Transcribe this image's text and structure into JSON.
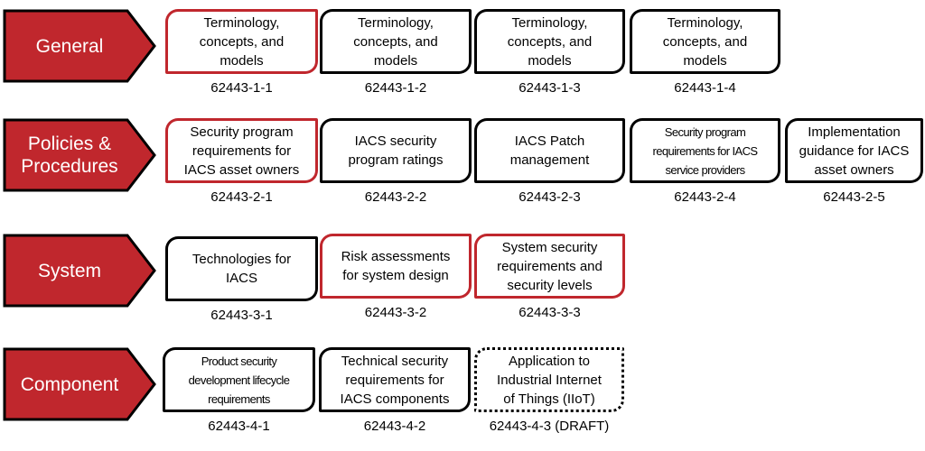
{
  "colors": {
    "accent_red": "#c0272d",
    "arrow_outline": "#000000",
    "box_border": "#000000",
    "text": "#000000"
  },
  "rows": [
    {
      "category": "General",
      "items": [
        {
          "title": "Terminology, concepts, and models",
          "lines": [
            "Terminology,",
            "concepts, and",
            "models"
          ],
          "code": "62443-1-1",
          "highlight": true
        },
        {
          "title": "Terminology, concepts, and models",
          "lines": [
            "Terminology,",
            "concepts, and",
            "models"
          ],
          "code": "62443-1-2",
          "highlight": false
        },
        {
          "title": "Terminology, concepts, and models",
          "lines": [
            "Terminology,",
            "concepts, and",
            "models"
          ],
          "code": "62443-1-3",
          "highlight": false
        },
        {
          "title": "Terminology, concepts, and models",
          "lines": [
            "Terminology,",
            "concepts, and",
            "models"
          ],
          "code": "62443-1-4",
          "highlight": false
        }
      ]
    },
    {
      "category": "Policies & Procedures",
      "items": [
        {
          "lines": [
            "Security program",
            "requirements for",
            "IACS asset owners"
          ],
          "code": "62443-2-1",
          "highlight": true
        },
        {
          "lines": [
            "IACS security",
            "program ratings"
          ],
          "code": "62443-2-2",
          "highlight": false
        },
        {
          "lines": [
            "IACS Patch",
            "management"
          ],
          "code": "62443-2-3",
          "highlight": false
        },
        {
          "lines": [
            "Security program",
            "requirements for IACS",
            "service providers"
          ],
          "code": "62443-2-4",
          "highlight": false
        },
        {
          "lines": [
            "Implementation",
            "guidance for IACS",
            "asset owners"
          ],
          "code": "62443-2-5",
          "highlight": false
        }
      ]
    },
    {
      "category": "System",
      "items": [
        {
          "lines": [
            "Technologies for",
            "IACS"
          ],
          "code": "62443-3-1",
          "highlight": false
        },
        {
          "lines": [
            "Risk assessments",
            "for system design"
          ],
          "code": "62443-3-2",
          "highlight": true
        },
        {
          "lines": [
            "System security",
            "requirements and",
            "security levels"
          ],
          "code": "62443-3-3",
          "highlight": true
        }
      ]
    },
    {
      "category": "Component",
      "items": [
        {
          "lines": [
            "Product security",
            "development lifecycle",
            "requirements"
          ],
          "code": "62443-4-1",
          "highlight": false
        },
        {
          "lines": [
            "Technical security",
            "requirements for",
            "IACS components"
          ],
          "code": "62443-4-2",
          "highlight": false
        },
        {
          "lines": [
            "Application to",
            "Industrial Internet",
            "of Things (IIoT)"
          ],
          "code": "62443-4-3 (DRAFT)",
          "highlight": false,
          "draft": true
        }
      ]
    }
  ]
}
